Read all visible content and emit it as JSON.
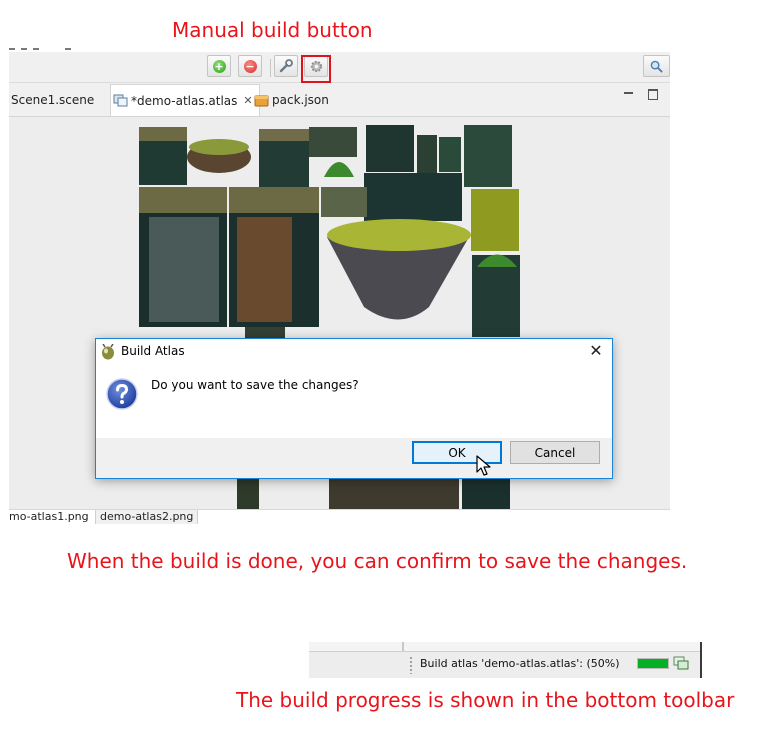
{
  "annotations": {
    "top": "Manual build button",
    "middle": "When the build is done, you can confirm to save the changes.",
    "bottom": "The build progress is shown in the bottom toolbar"
  },
  "colors": {
    "annotation": "#e8141b",
    "dialog_border": "#1883d7",
    "ok_focus": "#0078d7",
    "progress": "#06b025"
  },
  "toolbar": {
    "buttons": [
      {
        "icon": "add-icon"
      },
      {
        "icon": "remove-icon"
      },
      {
        "icon": "wrench-icon"
      },
      {
        "icon": "gear-icon"
      }
    ]
  },
  "tabs": [
    {
      "label": "Scene1.scene"
    },
    {
      "label": "*demo-atlas.atlas",
      "active": true,
      "close": "✕"
    },
    {
      "label": "pack.json"
    }
  ],
  "file_tabs": [
    "mo-atlas1.png",
    "demo-atlas2.png"
  ],
  "dialog": {
    "title": "Build Atlas",
    "message": "Do you want to save the changes?",
    "ok_label": "OK",
    "cancel_label": "Cancel",
    "close": "✕"
  },
  "status": {
    "text": "Build atlas 'demo-atlas.atlas': (50%)",
    "progress": 1.0
  }
}
